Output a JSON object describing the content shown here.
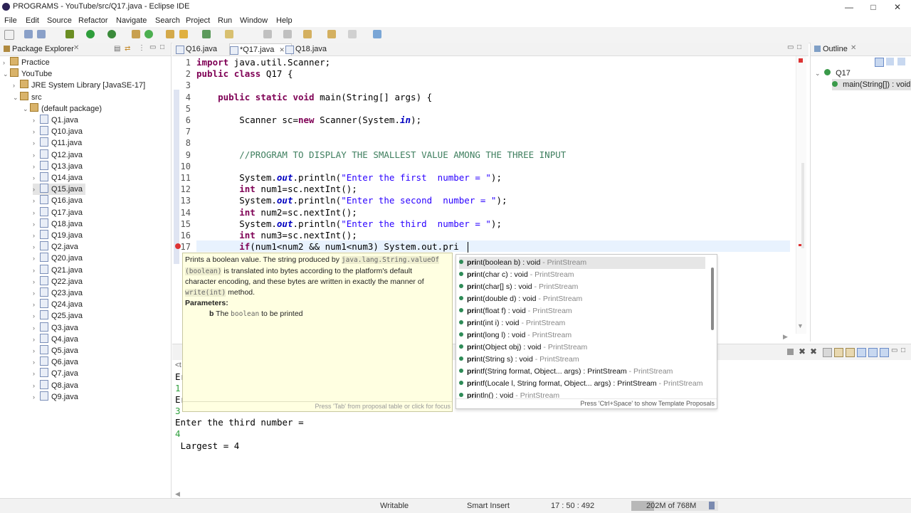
{
  "window": {
    "title": "PROGRAMS - YouTube/src/Q17.java - Eclipse IDE"
  },
  "menu": [
    "File",
    "Edit",
    "Source",
    "Refactor",
    "Navigate",
    "Search",
    "Project",
    "Run",
    "Window",
    "Help"
  ],
  "package_explorer": {
    "title": "Package Explorer",
    "items": [
      {
        "label": "Practice",
        "level": 0,
        "arrow": "›",
        "icon": "project-icon"
      },
      {
        "label": "YouTube",
        "level": 0,
        "arrow": "⌄",
        "icon": "project-icon"
      },
      {
        "label": "JRE System Library [JavaSE-17]",
        "level": 1,
        "arrow": "›",
        "icon": "library-icon"
      },
      {
        "label": "src",
        "level": 1,
        "arrow": "⌄",
        "icon": "src-folder-icon"
      },
      {
        "label": "(default package)",
        "level": 2,
        "arrow": "⌄",
        "icon": "package-icon"
      },
      {
        "label": "Q1.java",
        "level": 3,
        "arrow": "›",
        "icon": "java-file-icon"
      },
      {
        "label": "Q10.java",
        "level": 3,
        "arrow": "›",
        "icon": "java-file-icon"
      },
      {
        "label": "Q11.java",
        "level": 3,
        "arrow": "›",
        "icon": "java-file-icon"
      },
      {
        "label": "Q12.java",
        "level": 3,
        "arrow": "›",
        "icon": "java-file-icon"
      },
      {
        "label": "Q13.java",
        "level": 3,
        "arrow": "›",
        "icon": "java-file-icon"
      },
      {
        "label": "Q14.java",
        "level": 3,
        "arrow": "›",
        "icon": "java-file-icon"
      },
      {
        "label": "Q15.java",
        "level": 3,
        "arrow": "›",
        "icon": "java-file-icon",
        "selected": true
      },
      {
        "label": "Q16.java",
        "level": 3,
        "arrow": "›",
        "icon": "java-file-icon"
      },
      {
        "label": "Q17.java",
        "level": 3,
        "arrow": "›",
        "icon": "java-file-icon"
      },
      {
        "label": "Q18.java",
        "level": 3,
        "arrow": "›",
        "icon": "java-file-icon"
      },
      {
        "label": "Q19.java",
        "level": 3,
        "arrow": "›",
        "icon": "java-file-icon"
      },
      {
        "label": "Q2.java",
        "level": 3,
        "arrow": "›",
        "icon": "java-file-icon"
      },
      {
        "label": "Q20.java",
        "level": 3,
        "arrow": "›",
        "icon": "java-file-icon"
      },
      {
        "label": "Q21.java",
        "level": 3,
        "arrow": "›",
        "icon": "java-file-icon"
      },
      {
        "label": "Q22.java",
        "level": 3,
        "arrow": "›",
        "icon": "java-file-icon"
      },
      {
        "label": "Q23.java",
        "level": 3,
        "arrow": "›",
        "icon": "java-file-icon"
      },
      {
        "label": "Q24.java",
        "level": 3,
        "arrow": "›",
        "icon": "java-file-icon"
      },
      {
        "label": "Q25.java",
        "level": 3,
        "arrow": "›",
        "icon": "java-file-icon"
      },
      {
        "label": "Q3.java",
        "level": 3,
        "arrow": "›",
        "icon": "java-file-icon"
      },
      {
        "label": "Q4.java",
        "level": 3,
        "arrow": "›",
        "icon": "java-file-icon"
      },
      {
        "label": "Q5.java",
        "level": 3,
        "arrow": "›",
        "icon": "java-file-icon"
      },
      {
        "label": "Q6.java",
        "level": 3,
        "arrow": "›",
        "icon": "java-file-icon"
      },
      {
        "label": "Q7.java",
        "level": 3,
        "arrow": "›",
        "icon": "java-file-icon"
      },
      {
        "label": "Q8.java",
        "level": 3,
        "arrow": "›",
        "icon": "java-file-icon"
      },
      {
        "label": "Q9.java",
        "level": 3,
        "arrow": "›",
        "icon": "java-file-icon"
      }
    ]
  },
  "editor_tabs": [
    {
      "label": "Q16.java",
      "active": false
    },
    {
      "label": "*Q17.java",
      "active": true
    },
    {
      "label": "Q18.java",
      "active": false
    }
  ],
  "code_lines": [
    {
      "n": "1",
      "html": "<span class=\"kw\">import</span> java.util.Scanner;"
    },
    {
      "n": "2",
      "html": "<span class=\"kw\">public</span> <span class=\"kw\">class</span> Q17 {"
    },
    {
      "n": "3",
      "html": ""
    },
    {
      "n": "4",
      "html": "    <span class=\"kw\">public</span> <span class=\"kw\">static</span> <span class=\"kw\">void</span> main(String[] args) {"
    },
    {
      "n": "5",
      "html": ""
    },
    {
      "n": "6",
      "html": "        Scanner sc=<span class=\"kw\">new</span> Scanner(System.<span class=\"it\">in</span>);"
    },
    {
      "n": "7",
      "html": ""
    },
    {
      "n": "8",
      "html": ""
    },
    {
      "n": "9",
      "html": "        <span class=\"cm\">//PROGRAM TO DISPLAY THE SMALLEST VALUE AMONG THE THREE INPUT</span>"
    },
    {
      "n": "10",
      "html": ""
    },
    {
      "n": "11",
      "html": "        System.<span class=\"it\">out</span>.println(<span class=\"str\">\"Enter the first  number = \"</span>);"
    },
    {
      "n": "12",
      "html": "        <span class=\"kw\">int</span> num1=sc.nextInt();"
    },
    {
      "n": "13",
      "html": "        System.<span class=\"it\">out</span>.println(<span class=\"str\">\"Enter the second  number = \"</span>);"
    },
    {
      "n": "14",
      "html": "        <span class=\"kw\">int</span> num2=sc.nextInt();"
    },
    {
      "n": "15",
      "html": "        System.<span class=\"it\">out</span>.println(<span class=\"str\">\"Enter the third  number = \"</span>);"
    },
    {
      "n": "16",
      "html": "        <span class=\"kw\">int</span> num3=sc.nextInt();"
    },
    {
      "n": "17",
      "html": "        <span class=\"kw\">if</span>(num1&lt;num2 &amp;&amp; num1&lt;num3) System.out.pri"
    }
  ],
  "outline": {
    "title": "Outline",
    "class_item": "Q17",
    "method_item": "main(String[]) : void"
  },
  "javadoc_popup": {
    "line1": "Prints a boolean value. The string produced by",
    "code1": "java.lang.String.valueOf",
    "code2": "(boolean)",
    "line2": "is translated into bytes according to the platform's default",
    "line3": "character encoding, and these bytes are written in exactly the manner of",
    "code3": "write(int)",
    "line4": "method.",
    "params_label": "Parameters:",
    "param_name": "b",
    "param_text_pre": "The",
    "param_code": "boolean",
    "param_text_post": "to be printed",
    "footer": "Press 'Tab' from proposal table or click for focus"
  },
  "proposals": [
    {
      "bold": "pri",
      "rest": "nt(boolean b) : void",
      "src": "PrintStream",
      "selected": true
    },
    {
      "bold": "pri",
      "rest": "nt(char c) : void",
      "src": "PrintStream"
    },
    {
      "bold": "pri",
      "rest": "nt(char[] s) : void",
      "src": "PrintStream"
    },
    {
      "bold": "pri",
      "rest": "nt(double d) : void",
      "src": "PrintStream"
    },
    {
      "bold": "pri",
      "rest": "nt(float f) : void",
      "src": "PrintStream"
    },
    {
      "bold": "pri",
      "rest": "nt(int i) : void",
      "src": "PrintStream"
    },
    {
      "bold": "pri",
      "rest": "nt(long l) : void",
      "src": "PrintStream"
    },
    {
      "bold": "pri",
      "rest": "nt(Object obj) : void",
      "src": "PrintStream"
    },
    {
      "bold": "pri",
      "rest": "nt(String s) : void",
      "src": "PrintStream"
    },
    {
      "bold": "pri",
      "rest": "ntf(String format, Object... args) : PrintStream",
      "src": "PrintStream"
    },
    {
      "bold": "pri",
      "rest": "ntf(Locale l, String format, Object... args) : PrintStream",
      "src": "PrintStream"
    },
    {
      "bold": "pri",
      "rest": "ntln() : void",
      "src": "PrintStream"
    }
  ],
  "proposals_footer": "Press 'Ctrl+Space' to show Template Proposals",
  "console": {
    "tab_label": "<t",
    "partial_lines": [
      "Er",
      "1",
      "Er",
      "3",
      "Er"
    ],
    "line_third": "Enter the third number =",
    "value4": "4",
    "result": " Largest = 4"
  },
  "status": {
    "writable": "Writable",
    "insert_mode": "Smart Insert",
    "position": "17 : 50 : 492",
    "memory": "202M of 768M"
  },
  "colors": {
    "keyword": "#7f0055",
    "string": "#2a00ff",
    "comment": "#3f7f5f",
    "field": "#0000c0",
    "console_input": "#2e9e3b"
  }
}
